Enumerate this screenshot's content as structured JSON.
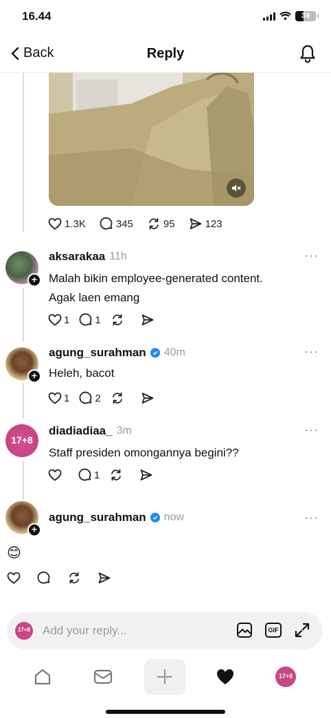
{
  "status_bar": {
    "time": "16.44",
    "battery": "39",
    "battery_level": 0.39
  },
  "header": {
    "back_label": "Back",
    "title": "Reply"
  },
  "post": {
    "likes": "1.3K",
    "comments": "345",
    "reposts": "95",
    "shares": "123"
  },
  "comments": [
    {
      "username": "aksarakaa",
      "time": "11h",
      "verified": false,
      "text_line1": "Malah bikin employee-generated content.",
      "text_line2": "Agak laen emang",
      "likes": "1",
      "replies": "1"
    },
    {
      "username": "agung_surahman",
      "time": "40m",
      "verified": true,
      "text_line1": "Heleh, bacot",
      "likes": "1",
      "replies": "2"
    },
    {
      "username": "diadiadiaa_",
      "time": "3m",
      "verified": false,
      "avatar_text": "17+8",
      "text_line1": "Staff presiden omongannya begini??",
      "likes": "",
      "replies": "1"
    },
    {
      "username": "agung_surahman",
      "time": "now",
      "verified": true,
      "text_line1": "😊",
      "likes": "",
      "replies": ""
    }
  ],
  "reply_bar": {
    "placeholder": "Add your reply...",
    "gif_label": "GIF",
    "avatar_text": "17+8"
  },
  "tab_bar": {
    "profile_text": "17+8"
  },
  "colors": {
    "verified": "#1d8cf0",
    "avatar_pink": "#c94687",
    "muted_text": "#9a9a9a"
  }
}
